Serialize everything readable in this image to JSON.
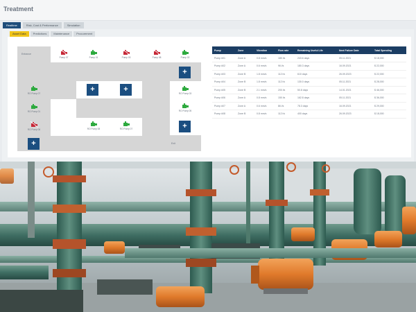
{
  "app": {
    "title": "Treatment"
  },
  "tabs": [
    {
      "label": "Realtime",
      "active": true
    },
    {
      "label": "Risk, Cost & Performance",
      "active": false
    },
    {
      "label": "Simulation",
      "active": false
    }
  ],
  "subtabs": [
    {
      "label": "Asset Data",
      "active": true
    },
    {
      "label": "Predictions",
      "active": false
    },
    {
      "label": "Maintenance",
      "active": false
    },
    {
      "label": "Procurement",
      "active": false
    }
  ],
  "layout": {
    "entrance_label": "Entrance",
    "exit_label": "Exit",
    "add_label": "+"
  },
  "pumps": {
    "r1": [
      "Pump 07",
      "Pump 01",
      "Pump 03",
      "Pump 08",
      "Pump 02"
    ],
    "right_col": [
      "RO Pump 03",
      "RO Pump 05"
    ],
    "left_col": [
      "RO Pump 07",
      "RO Pump 01",
      "RO Pump 06"
    ],
    "center": [
      "RO Pump 08",
      "RO Pump 07"
    ]
  },
  "colors": {
    "ok": "#2eaa3f",
    "fault": "#c62837",
    "accent": "#1b4e80",
    "header": "#1b3d63"
  },
  "table": {
    "headers": [
      "Pump",
      "Zone",
      "Vibration",
      "Flow rate",
      "Remaining Useful Life",
      "Next Failure Date",
      "Total Spending"
    ],
    "rows": [
      [
        "Pump #01",
        "Zone A",
        "0.8 mm/s",
        "180 l/s",
        "243.6 days",
        "05.11.2021",
        "$ 18,000"
      ],
      [
        "Pump #02",
        "Zone A",
        "0.6 mm/s",
        "96 l/s",
        "180.3 days",
        "16.09.2021",
        "$ 22,000"
      ],
      [
        "Pump #03",
        "Zone B",
        "1.8 mm/s",
        "112 l/s",
        "610 days",
        "26.09.2023",
        "$ 22,000"
      ],
      [
        "Pump #04",
        "Zone B",
        "1.8 mm/s",
        "112 l/s",
        "130.0 days",
        "05.11.2021",
        "$ 28,000"
      ],
      [
        "Pump #05",
        "Zone B",
        "2.1 mm/s",
        "200 l/s",
        "50.8 days",
        "14.01.2021",
        "$ 46,000"
      ],
      [
        "Pump #06",
        "Zone A",
        "0.8 mm/s",
        "150 l/s",
        "162.8 days",
        "05.11.2021",
        "$ 36,000"
      ],
      [
        "Pump #07",
        "Zone A",
        "0.6 mm/s",
        "86 l/s",
        "78.3 days",
        "16.09.2021",
        "$ 29,000"
      ],
      [
        "Pump #08",
        "Zone B",
        "0.8 mm/s",
        "112 l/s",
        "400 days",
        "26.09.2023",
        "$ 18,000"
      ]
    ]
  }
}
